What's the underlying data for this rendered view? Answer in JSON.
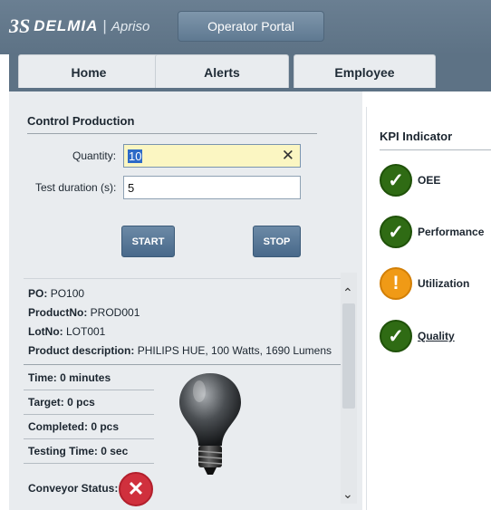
{
  "header": {
    "logo_mark": "3S",
    "brand": "DELMIA",
    "brand_separator": "|",
    "product": "Apriso",
    "portal_button": "Operator Portal"
  },
  "tabs": [
    {
      "label": "Home"
    },
    {
      "label": "Alerts"
    },
    {
      "label": "Employee"
    }
  ],
  "control": {
    "title": "Control Production",
    "quantity_label": "Quantity:",
    "quantity_value": "10",
    "clear_symbol": "✕",
    "duration_label": "Test duration (s):",
    "duration_value": "5",
    "start_label": "START",
    "stop_label": "STOP"
  },
  "order": {
    "po_label": "PO:",
    "po_value": "PO100",
    "product_label": "ProductNo:",
    "product_value": "PROD001",
    "lot_label": "LotNo:",
    "lot_value": "LOT001",
    "desc_label": "Product description:",
    "desc_value": "PHILIPS HUE, 100 Watts, 1690 Lumens"
  },
  "metrics": {
    "time": "Time: 0 minutes",
    "target": "Target: 0 pcs",
    "completed": "Completed: 0 pcs",
    "testing_time": "Testing Time: 0 sec",
    "conveyor_label": "Conveyor Status:",
    "conveyor_state": "error"
  },
  "kpi": {
    "title": "KPI Indicator",
    "items": [
      {
        "label": "OEE",
        "status": "ok",
        "icon": "check-icon"
      },
      {
        "label": "Performance",
        "status": "ok",
        "icon": "check-icon"
      },
      {
        "label": "Utilization",
        "status": "warning",
        "icon": "exclamation-icon"
      },
      {
        "label": "Quality",
        "status": "ok",
        "icon": "check-icon"
      }
    ]
  },
  "colors": {
    "header": "#5d7285",
    "button": "#48698a",
    "ok": "#2f6b14",
    "warning": "#f09a16",
    "error": "#d0303d",
    "input_highlight": "#fbf6c2"
  }
}
